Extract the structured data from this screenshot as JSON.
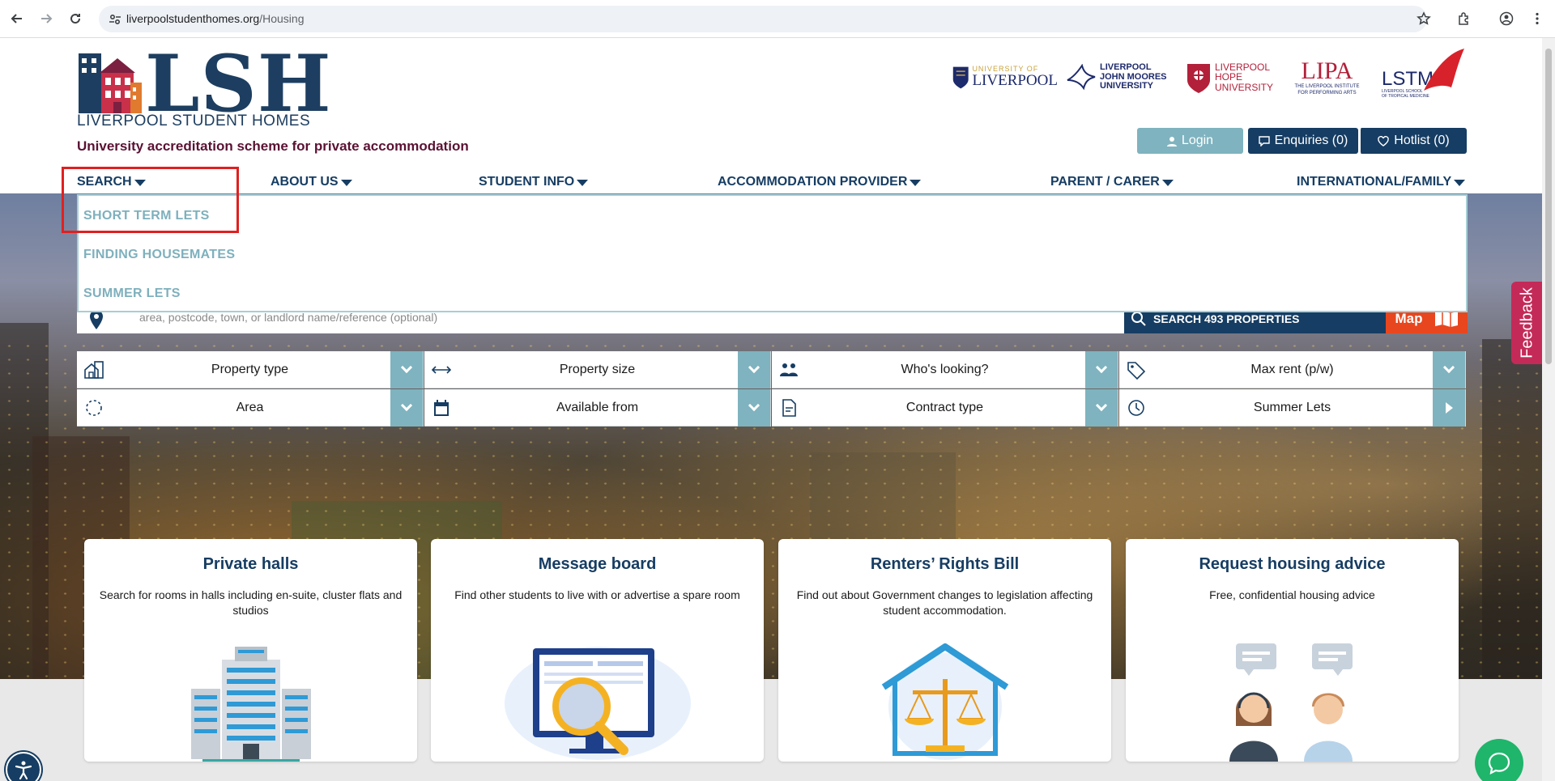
{
  "browser": {
    "url_domain": "liverpoolstudenthomes.org",
    "url_path": "/Housing"
  },
  "header": {
    "logo_text": "LSH",
    "logo_subtitle": "LIVERPOOL STUDENT HOMES",
    "tagline": "University accreditation scheme for private accommodation",
    "partners": [
      {
        "line1": "UNIVERSITY OF",
        "line2": "LIVERPOOL"
      },
      {
        "line1": "LIVERPOOL",
        "line2": "JOHN MOORES",
        "line3": "UNIVERSITY"
      },
      {
        "line1": "LIVERPOOL",
        "line2": "HOPE",
        "line3": "UNIVERSITY"
      },
      {
        "line1": "LIPA",
        "line2": "THE LIVERPOOL INSTITUTE",
        "line3": "FOR PERFORMING ARTS"
      },
      {
        "line1": "LSTM",
        "line2": "LIVERPOOL SCHOOL",
        "line3": "OF TROPICAL MEDICINE"
      }
    ],
    "login_label": "Login",
    "enquiries_label": "Enquiries (0)",
    "hotlist_label": "Hotlist (0)"
  },
  "nav": {
    "items": [
      {
        "label": "SEARCH"
      },
      {
        "label": "ABOUT US"
      },
      {
        "label": "STUDENT INFO"
      },
      {
        "label": "ACCOMMODATION PROVIDER"
      },
      {
        "label": "PARENT / CARER"
      },
      {
        "label": "INTERNATIONAL/FAMILY"
      }
    ],
    "dropdown": [
      "SHORT TERM LETS",
      "FINDING HOUSEMATES",
      "SUMMER LETS"
    ]
  },
  "search": {
    "placeholder": "area, postcode, town, or landlord name/reference (optional)",
    "button_label": "SEARCH 493 PROPERTIES",
    "map_label": "Map"
  },
  "filters": [
    {
      "label": "Property type",
      "icon": "house-icon"
    },
    {
      "label": "Property size",
      "icon": "arrows-horizontal-icon"
    },
    {
      "label": "Who's looking?",
      "icon": "people-icon"
    },
    {
      "label": "Max rent (p/w)",
      "icon": "tag-icon"
    },
    {
      "label": "Area",
      "icon": "dashed-circle-icon"
    },
    {
      "label": "Available from",
      "icon": "calendar-icon"
    },
    {
      "label": "Contract type",
      "icon": "document-icon"
    },
    {
      "label": "Summer Lets",
      "icon": "clock-icon"
    }
  ],
  "cards": [
    {
      "title": "Private halls",
      "text": "Search for rooms in halls including en-suite, cluster flats and studios"
    },
    {
      "title": "Message board",
      "text": "Find other students to live with or advertise a spare room"
    },
    {
      "title": "Renters’ Rights Bill",
      "text": "Find out about Government changes to legislation affecting student accommodation."
    },
    {
      "title": "Request housing advice",
      "text": "Free, confidential housing advice"
    }
  ],
  "widgets": {
    "feedback_label": "Feedback"
  },
  "colors": {
    "brand_navy": "#163d63",
    "accent_teal": "#7fb3bf",
    "map_orange": "#e8461e",
    "feedback_pink": "#c42a58",
    "highlight_red": "#e02020",
    "chat_green": "#1fb56b"
  }
}
